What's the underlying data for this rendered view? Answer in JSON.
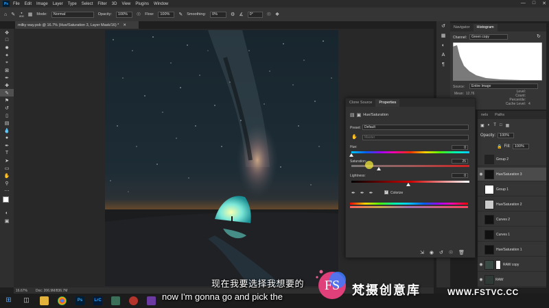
{
  "menu": {
    "items": [
      "File",
      "Edit",
      "Image",
      "Layer",
      "Type",
      "Select",
      "Filter",
      "3D",
      "View",
      "Plugins",
      "Window"
    ]
  },
  "options": {
    "brush_size": "800",
    "mode_label": "Mode:",
    "mode_value": "Normal",
    "opacity_label": "Opacity:",
    "opacity_value": "100%",
    "flow_label": "Flow:",
    "flow_value": "100%",
    "smoothing_label": "Smoothing:",
    "smoothing_value": "0%",
    "angle_value": "0°"
  },
  "document": {
    "tab_title": "milky way.psb @ 16.7% (Hue/Saturation 3, Layer Mask/16) *"
  },
  "status": {
    "zoom": "16.67%",
    "doc": "Doc: 206.9M/836.7M"
  },
  "histogram": {
    "tabs": [
      "Navigator",
      "Histogram"
    ],
    "active_tab": "Histogram",
    "channel_label": "Channel:",
    "channel_value": "Green copy",
    "source_label": "Source:",
    "source_value": "Entire Image",
    "mean_label": "Mean:",
    "mean_value": "12.76",
    "level_label": "Level:",
    "count_label": "Count:",
    "percentile_label": "Percentile:",
    "cache_label": "Cache Level:",
    "cache_value": "4",
    "partial_num": "80"
  },
  "properties": {
    "tabs": [
      "Clone Source",
      "Properties"
    ],
    "active_tab": "Properties",
    "adjustment": "Hue/Saturation",
    "preset_label": "Preset:",
    "preset_value": "Default",
    "master_value": "Master",
    "hue_label": "Hue:",
    "hue_value": "0",
    "saturation_label": "Saturation:",
    "saturation_value": "25",
    "saturation_level": 0.25,
    "lightness_label": "Lightness:",
    "lightness_value": "0",
    "colorize_label": "Colorize",
    "colorize_checked": true
  },
  "layers_panel": {
    "tab_labels": [
      "nels",
      "Paths"
    ],
    "opacity_label": "Opacity:",
    "opacity_value": "100%",
    "fill_label": "Fill:",
    "fill_value": "100%",
    "layers": [
      {
        "name": "Group 2"
      },
      {
        "name": "Hue/Saturation 3",
        "selected": true
      },
      {
        "name": "Group 1"
      },
      {
        "name": "Hue/Saturation 2"
      },
      {
        "name": "Curves 2"
      },
      {
        "name": "Curves 1"
      },
      {
        "name": "Hue/Saturation 1"
      },
      {
        "name": "RAW copy"
      },
      {
        "name": "RAW"
      }
    ]
  },
  "subtitles": {
    "zh": "现在我要选择我想要的",
    "en": "now I'm gonna go and pick the"
  },
  "watermark": {
    "logo_text": "FS",
    "cn_text": "梵摄创意库",
    "url": "WWW.FSTVC.CC"
  },
  "colors": {
    "accent": "#31a8ff",
    "panel": "#353535",
    "watermark_pink": "#e0407a",
    "watermark_blue": "#3b7bff"
  },
  "icons": [
    "home-icon",
    "brush-icon",
    "move-icon",
    "eye-icon",
    "trash-icon",
    "fs-logo-icon"
  ]
}
